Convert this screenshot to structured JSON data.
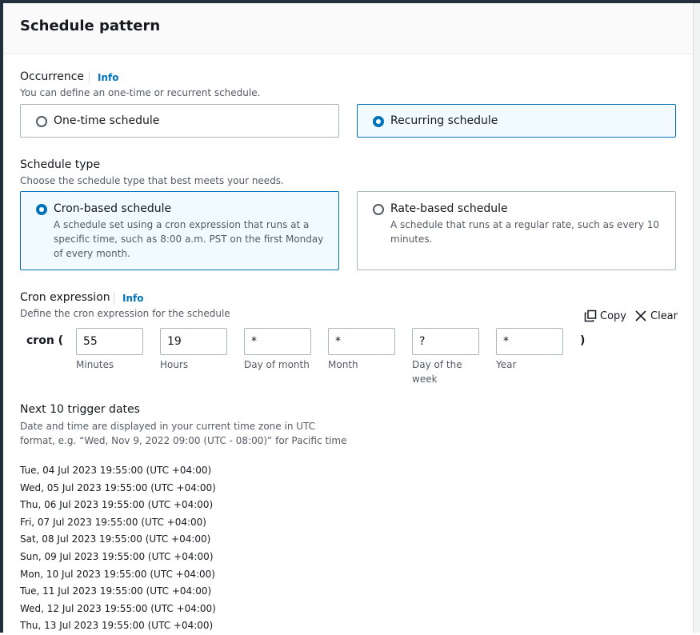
{
  "section": {
    "title": "Schedule pattern"
  },
  "occurrence": {
    "label": "Occurrence",
    "info": "Info",
    "description": "You can define an one-time or recurrent schedule.",
    "options": [
      {
        "label": "One-time schedule",
        "selected": false
      },
      {
        "label": "Recurring schedule",
        "selected": true
      }
    ]
  },
  "schedule_type": {
    "label": "Schedule type",
    "description": "Choose the schedule type that best meets your needs.",
    "options": [
      {
        "label": "Cron-based schedule",
        "desc_lines": [
          "A schedule set using a cron expression that runs at a",
          "specific time, such as 8:00 a.m. PST on the first Monday",
          "of every month."
        ],
        "selected": true
      },
      {
        "label": "Rate-based schedule",
        "desc_lines": [
          "A schedule that runs at a regular rate, such as every 10",
          "minutes."
        ],
        "selected": false
      }
    ]
  },
  "cron": {
    "label": "Cron expression",
    "info": "Info",
    "description": "Define the cron expression for the schedule",
    "copy_label": "Copy",
    "clear_label": "Clear",
    "prefix": "cron (",
    "suffix": ")",
    "fields": [
      {
        "value": "55",
        "label": "Minutes"
      },
      {
        "value": "19",
        "label": "Hours"
      },
      {
        "value": "*",
        "label": "Day of month"
      },
      {
        "value": "*",
        "label": "Month"
      },
      {
        "value": "?",
        "label_lines": [
          "Day of the",
          "week"
        ]
      },
      {
        "value": "*",
        "label": "Year"
      }
    ]
  },
  "triggers": {
    "label": "Next 10 trigger dates",
    "desc_lines": [
      "Date and time are displayed in your current time zone in UTC",
      "format, e.g. “Wed, Nov 9, 2022 09:00 (UTC - 08:00)” for Pacific time"
    ],
    "dates": [
      "Tue, 04 Jul 2023 19:55:00 (UTC +04:00)",
      "Wed, 05 Jul 2023 19:55:00 (UTC +04:00)",
      "Thu, 06 Jul 2023 19:55:00 (UTC +04:00)",
      "Fri, 07 Jul 2023 19:55:00 (UTC +04:00)",
      "Sat, 08 Jul 2023 19:55:00 (UTC +04:00)",
      "Sun, 09 Jul 2023 19:55:00 (UTC +04:00)",
      "Mon, 10 Jul 2023 19:55:00 (UTC +04:00)",
      "Tue, 11 Jul 2023 19:55:00 (UTC +04:00)",
      "Wed, 12 Jul 2023 19:55:00 (UTC +04:00)",
      "Thu, 13 Jul 2023 19:55:00 (UTC +04:00)"
    ]
  },
  "icons": {
    "copy": "copy-icon",
    "clear": "close-icon"
  },
  "colors": {
    "accent": "#0073bb",
    "selected_bg": "#f1faff",
    "text": "#16191f",
    "muted": "#545b64"
  }
}
